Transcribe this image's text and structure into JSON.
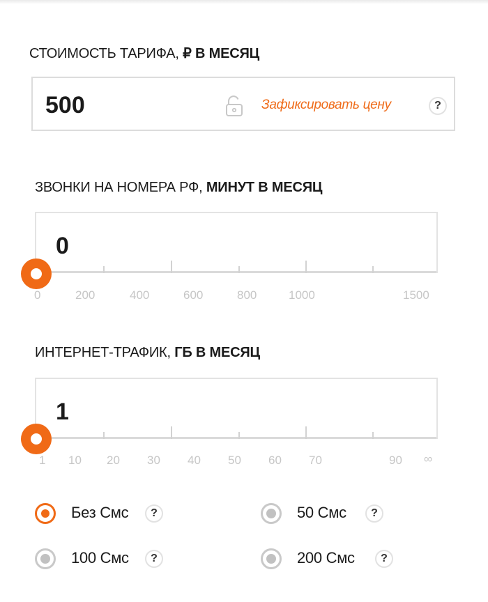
{
  "price": {
    "label_normal": "СТОИМОСТЬ ТАРИФА, ",
    "label_bold": "₽ В МЕСЯЦ",
    "value": "500",
    "fix_label": "Зафиксировать цену",
    "help": "?"
  },
  "calls": {
    "label_normal": "ЗВОНКИ НА НОМЕРА РФ, ",
    "label_bold": "МИНУТ В МЕСЯЦ",
    "value": "0",
    "scale": [
      "0",
      "200",
      "400",
      "600",
      "800",
      "1000",
      "1500"
    ],
    "slider_level": 0
  },
  "internet": {
    "label_normal": "ИНТЕРНЕТ-ТРАФИК, ",
    "label_bold": "ГБ В МЕСЯЦ",
    "value": "1",
    "scale": [
      "1",
      "10",
      "20",
      "30",
      "40",
      "50",
      "60",
      "70",
      "90",
      "∞"
    ],
    "slider_level": 0
  },
  "sms": {
    "options": [
      {
        "label": "Без Смс",
        "selected": true
      },
      {
        "label": "50 Смс",
        "selected": false
      },
      {
        "label": "100 Смс",
        "selected": false
      },
      {
        "label": "200 Смс",
        "selected": false
      }
    ],
    "help": "?"
  },
  "colors": {
    "accent": "#f06a16",
    "link": "#ef6c1a",
    "scale_text": "#c6c6c6",
    "border": "#dcdcdc"
  },
  "icons": {
    "lock": "unlocked-padlock-icon"
  }
}
